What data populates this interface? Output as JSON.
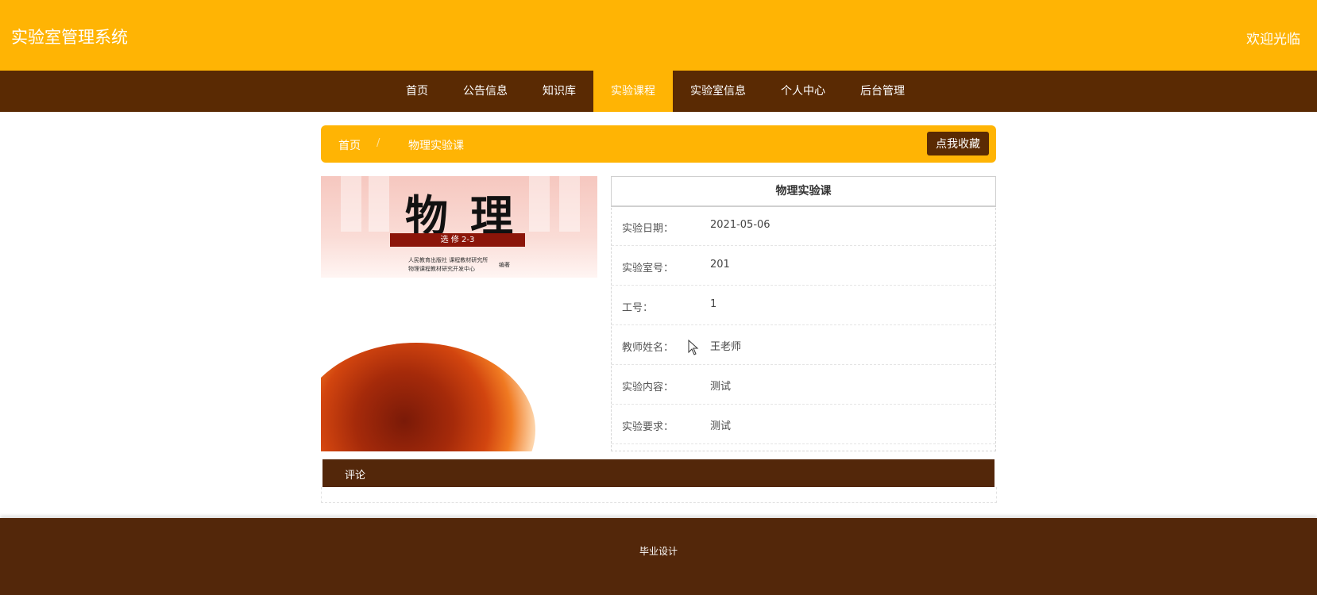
{
  "header": {
    "site_title": "实验室管理系统",
    "welcome": "欢迎光临"
  },
  "nav": {
    "items": [
      {
        "label": "首页"
      },
      {
        "label": "公告信息"
      },
      {
        "label": "知识库"
      },
      {
        "label": "实验课程",
        "active": true
      },
      {
        "label": "实验室信息"
      },
      {
        "label": "个人中心"
      },
      {
        "label": "后台管理"
      }
    ]
  },
  "breadcrumb": {
    "home": "首页",
    "separator": "/",
    "current": "物理实验课",
    "favorite_button": "点我收藏"
  },
  "cover": {
    "title": "物理",
    "subtitle": "选 修 2-3",
    "publisher_line1": "人民教育出版社  课程教材研究所",
    "publisher_line2": "物理课程教材研究开发中心",
    "publisher_suffix": "编著"
  },
  "detail": {
    "title": "物理实验课",
    "rows": [
      {
        "label": "实验日期：",
        "value": "2021-05-06"
      },
      {
        "label": "实验室号：",
        "value": "201"
      },
      {
        "label": "工号：",
        "value": "1"
      },
      {
        "label": "教师姓名：",
        "value": "王老师"
      },
      {
        "label": "实验内容：",
        "value": "测试"
      },
      {
        "label": "实验要求：",
        "value": "测试"
      }
    ]
  },
  "comments": {
    "label": "评论"
  },
  "footer": {
    "text": "毕业设计"
  },
  "colors": {
    "primary": "#FFB404",
    "dark": "#5A2A03",
    "footer": "#53270A"
  }
}
